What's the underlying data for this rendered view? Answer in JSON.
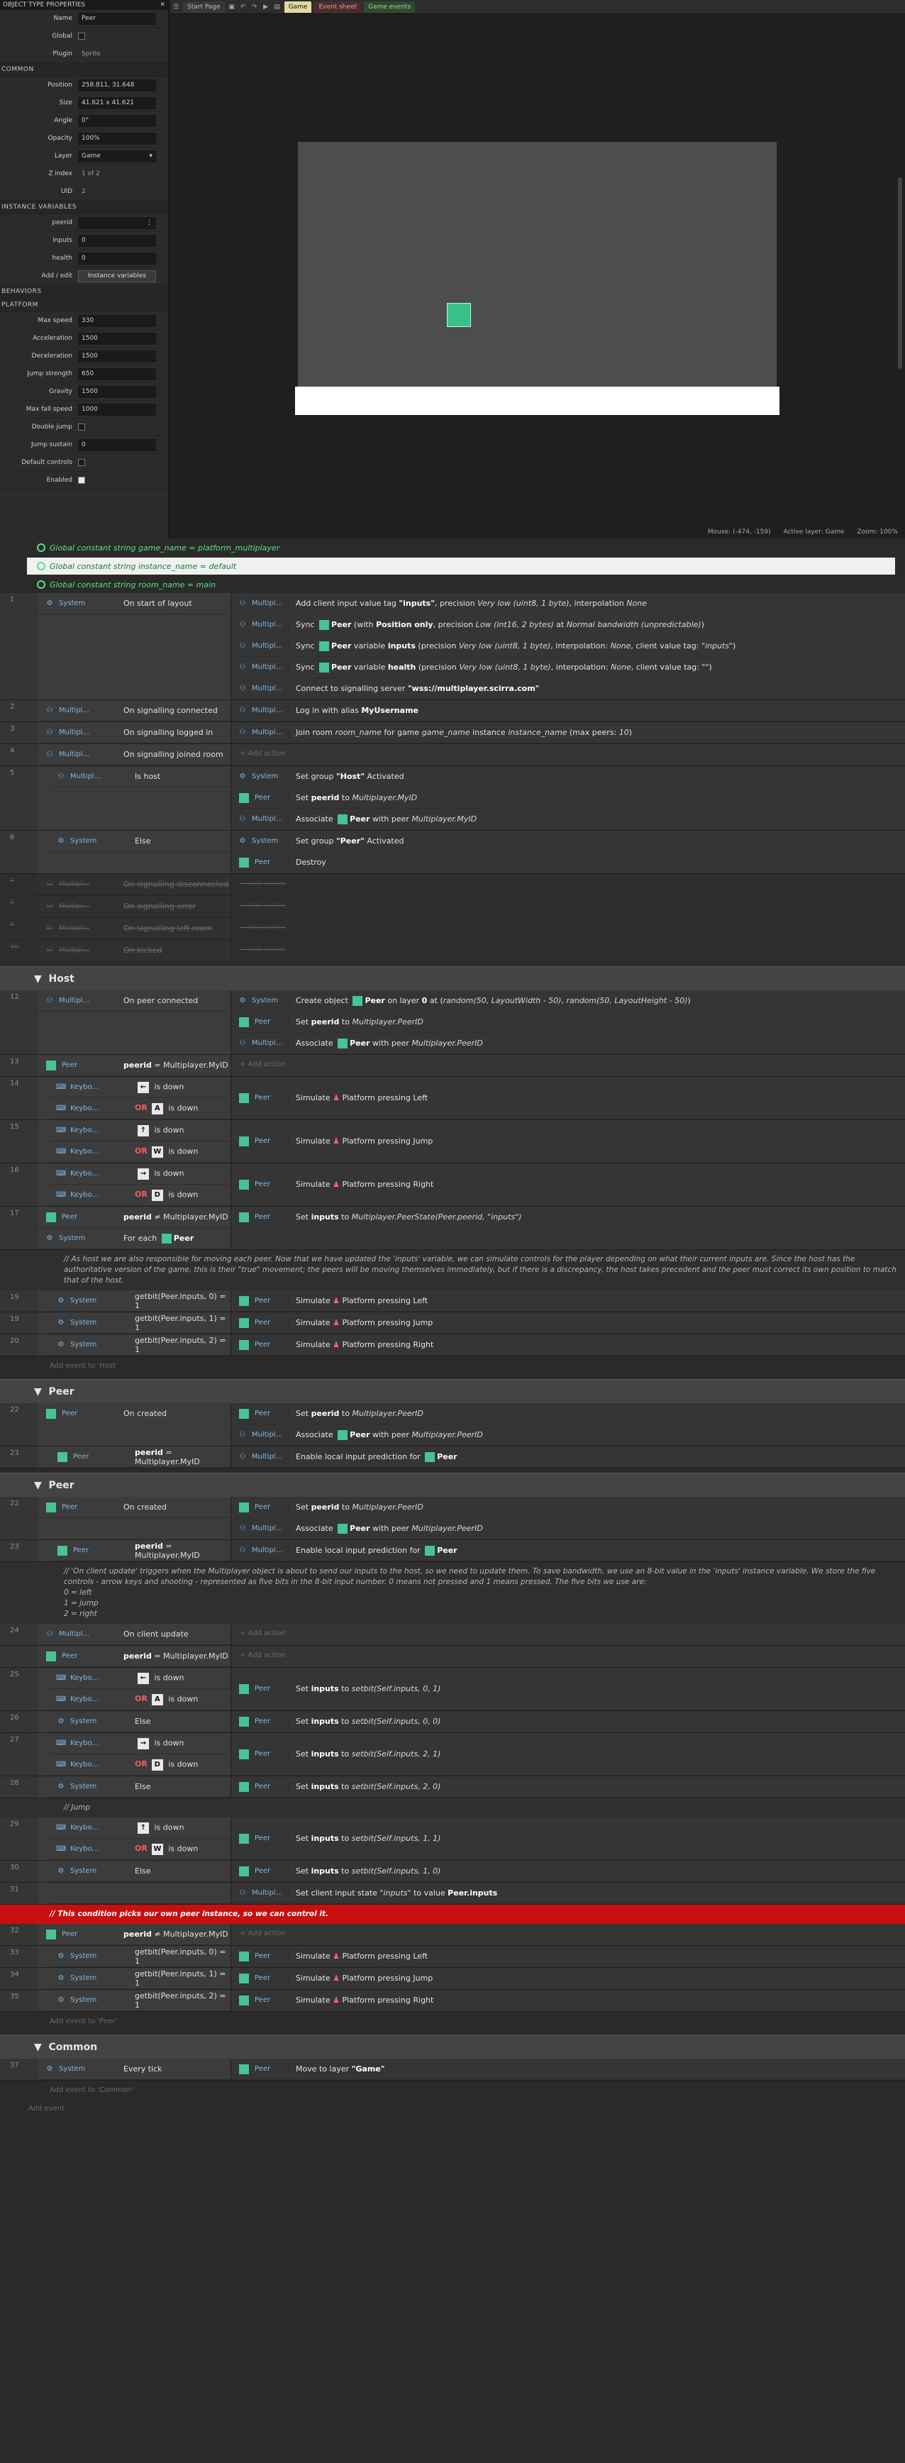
{
  "props": {
    "title": "OBJECT TYPE PROPERTIES",
    "sections": {
      "common": "COMMON",
      "instvars": "INSTANCE VARIABLES",
      "behaviors": "BEHAVIORS",
      "platform": "PLATFORM"
    },
    "name_label": "Name",
    "name_value": "Peer",
    "global_label": "Global",
    "plugin_label": "Plugin",
    "plugin_value": "Sprite",
    "position_label": "Position",
    "position_value": "258.811, 31.648",
    "size_label": "Size",
    "size_value": "41.621 x 41.621",
    "angle_label": "Angle",
    "angle_value": "0°",
    "opacity_label": "Opacity",
    "opacity_value": "100%",
    "layer_label": "Layer",
    "layer_value": "Game",
    "zindex_label": "Z index",
    "zindex_value": "1 of 2",
    "uid_label": "UID",
    "uid_value": "2",
    "peerid_label": "peerid",
    "peerid_value": "",
    "inputs_label": "inputs",
    "inputs_value": "0",
    "health_label": "health",
    "health_value": "0",
    "addedit_label": "Add / edit",
    "addedit_btn": "Instance variables",
    "maxspeed_label": "Max speed",
    "maxspeed_value": "330",
    "accel_label": "Acceleration",
    "accel_value": "1500",
    "decel_label": "Deceleration",
    "decel_value": "1500",
    "jump_label": "Jump strength",
    "jump_value": "650",
    "gravity_label": "Gravity",
    "gravity_value": "1500",
    "maxfall_label": "Max fall speed",
    "maxfall_value": "1000",
    "double_label": "Double jump",
    "jumpsus_label": "Jump sustain",
    "jumpsus_value": "0",
    "defctrl_label": "Default controls",
    "enabled_label": "Enabled"
  },
  "tabs": {
    "start": "Start Page",
    "game": "Game",
    "event": "Event sheet",
    "game_ev": "Game events"
  },
  "status": {
    "mouse": "Mouse: (-474, -159)",
    "layer": "Active layer: Game",
    "zoom": "Zoom: 100%"
  },
  "globals": [
    "Global constant string game_name = platform_multiplayer",
    "Global constant string instance_name = default",
    "Global constant string room_name = main"
  ],
  "groups": {
    "host": "Host",
    "peer1": "Peer",
    "peer2": "Peer",
    "common": "Common"
  },
  "comments": {
    "host": "// As host we are also responsible for moving each peer. Now that we have updated the 'inputs' variable, we can simulate controls for the player depending on what their current inputs are. Since the host has the authoritative version of the game, this is their \"true\" movement; the peers will be moving themselves immediately, but if there is a discrepancy, the host takes precedent and the peer must correct its own position to match that of the host.",
    "client": "// 'On client update' triggers when the Multiplayer object is about to send our inputs to the host, so we need to update them. To save bandwidth, we use an 8-bit value in the 'inputs' instance variable. We store the five controls - arrow keys and shooting - represented as five bits in the 8-bit input number. 0 means not pressed and 1 means pressed. The five bits we use are:",
    "client_b0": "0 = left",
    "client_b1": "1 = jump",
    "client_b2": "2 = right",
    "jump": "// Jump",
    "red": "// This condition picks our own peer instance, so we can control it."
  },
  "labels": {
    "add_action": "+ Add action",
    "add_ev_host": "Add event to 'Host'",
    "add_ev_peer": "Add event to 'Peer'",
    "add_ev_common": "Add event to 'Common'",
    "add_ev": "Add event"
  }
}
